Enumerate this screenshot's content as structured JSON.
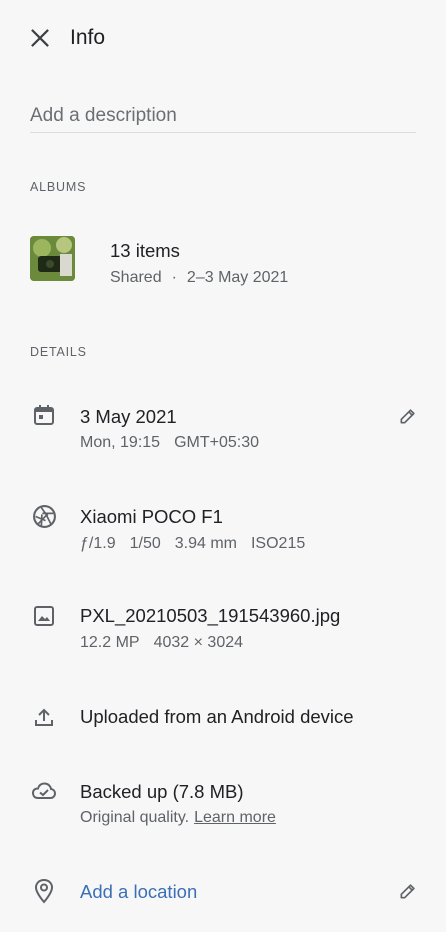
{
  "header": {
    "title": "Info",
    "close_icon": "close-icon"
  },
  "description": {
    "placeholder": "Add a description",
    "value": ""
  },
  "albums": {
    "section_label": "ALBUMS",
    "items": [
      {
        "title": "13 items",
        "shared": "Shared",
        "separator": "·",
        "date_range": "2–3 May 2021"
      }
    ]
  },
  "details": {
    "section_label": "DETAILS",
    "date": {
      "primary": "3 May 2021",
      "day_time": "Mon, 19:15",
      "timezone": "GMT+05:30",
      "icon": "calendar-icon",
      "edit_icon": "pencil-icon"
    },
    "camera": {
      "primary": "Xiaomi POCO F1",
      "aperture": "ƒ/1.9",
      "shutter": "1/50",
      "focal": "3.94 mm",
      "iso": "ISO215",
      "icon": "aperture-icon"
    },
    "file": {
      "primary": "PXL_20210503_191543960.jpg",
      "megapixels": "12.2 MP",
      "resolution": "4032 × 3024",
      "icon": "image-icon"
    },
    "upload": {
      "primary": "Uploaded from an Android device",
      "icon": "upload-icon"
    },
    "backup": {
      "primary": "Backed up (7.8 MB)",
      "quality": "Original quality.",
      "learn_more": "Learn more",
      "icon": "cloud-done-icon"
    },
    "location": {
      "primary": "Add a location",
      "icon": "location-pin-icon",
      "edit_icon": "pencil-icon"
    }
  }
}
